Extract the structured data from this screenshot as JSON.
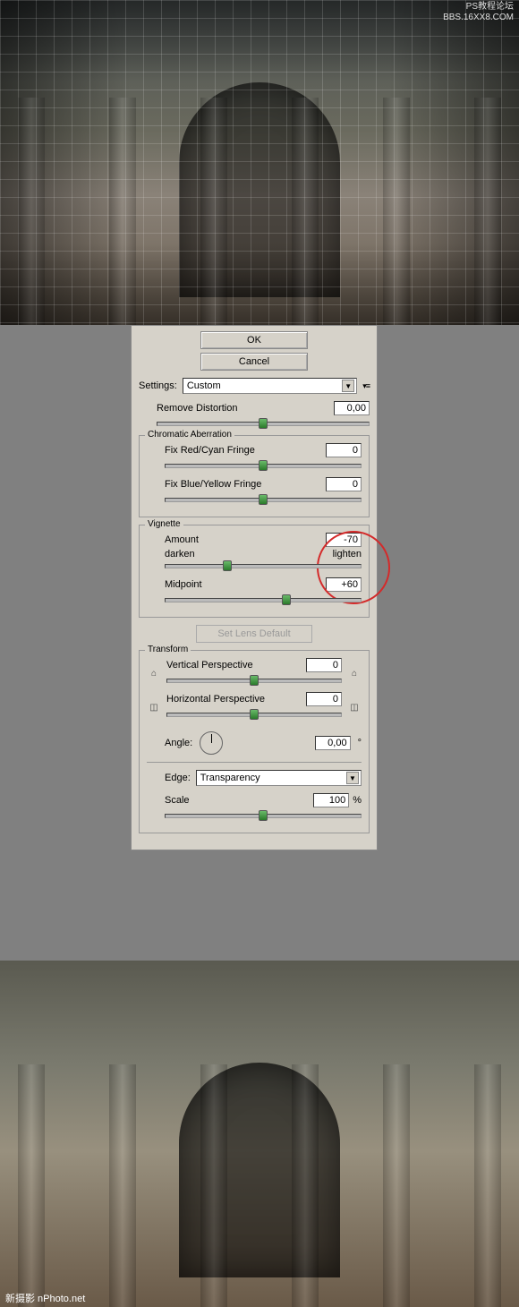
{
  "watermark": {
    "line1": "PS教程论坛",
    "line2": "BBS.16XX8.COM",
    "bottom": "新摄影 nPhoto.net"
  },
  "buttons": {
    "ok": "OK",
    "cancel": "Cancel"
  },
  "settings": {
    "label": "Settings:",
    "value": "Custom"
  },
  "distortion": {
    "label": "Remove Distortion",
    "value": "0,00"
  },
  "chromatic": {
    "group": "Chromatic Aberration",
    "red_label": "Fix Red/Cyan Fringe",
    "red_value": "0",
    "blue_label": "Fix Blue/Yellow Fringe",
    "blue_value": "0"
  },
  "vignette": {
    "group": "Vignette",
    "amount_label": "Amount",
    "amount_value": "-70",
    "darken": "darken",
    "lighten": "lighten",
    "midpoint_label": "Midpoint",
    "midpoint_value": "+60"
  },
  "set_default": "Set Lens Default",
  "transform": {
    "group": "Transform",
    "vpersp_label": "Vertical Perspective",
    "vpersp_value": "0",
    "hpersp_label": "Horizontal Perspective",
    "hpersp_value": "0",
    "angle_label": "Angle:",
    "angle_value": "0,00",
    "angle_unit": "°",
    "edge_label": "Edge:",
    "edge_value": "Transparency",
    "scale_label": "Scale",
    "scale_value": "100",
    "scale_unit": "%"
  }
}
